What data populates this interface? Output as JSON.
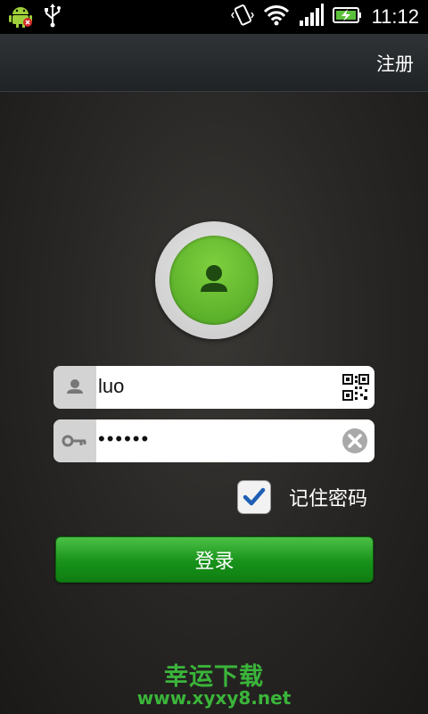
{
  "status_bar": {
    "time": "11:12",
    "icons": [
      "android-debug-icon",
      "usb-icon",
      "vibrate-icon",
      "wifi-icon",
      "signal-icon",
      "battery-charging-icon"
    ]
  },
  "header": {
    "register_label": "注册"
  },
  "login_form": {
    "username_value": "luo",
    "password_value": "••••••",
    "remember_label": "记住密码",
    "remember_checked": true,
    "login_label": "登录"
  },
  "watermark": {
    "title": "幸运下载",
    "url": "www.xyxy8.net"
  },
  "colors": {
    "accent_green": "#4fa524",
    "button_green": "#18921a",
    "watermark_green": "#3ab53a"
  }
}
